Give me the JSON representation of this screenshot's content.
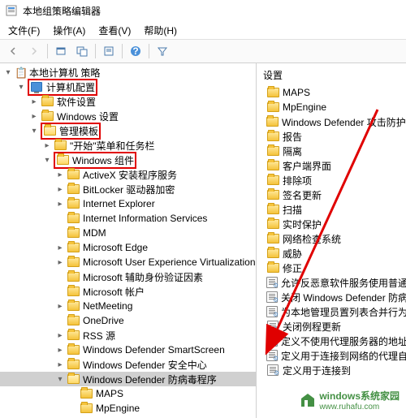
{
  "window": {
    "title": "本地组策略编辑器"
  },
  "menu": {
    "file": "文件(F)",
    "action": "操作(A)",
    "view": "查看(V)",
    "help": "帮助(H)"
  },
  "tree": {
    "root": "本地计算机 策略",
    "computer_config": "计算机配置",
    "software_settings": "软件设置",
    "windows_settings": "Windows 设置",
    "admin_templates": "管理模板",
    "start_taskbar": "\"开始\"菜单和任务栏",
    "windows_components": "Windows 组件",
    "items": [
      "ActiveX 安装程序服务",
      "BitLocker 驱动器加密",
      "Internet Explorer",
      "Internet Information Services",
      "MDM",
      "Microsoft Edge",
      "Microsoft User Experience Virtualization",
      "Microsoft 辅助身份验证因素",
      "Microsoft 帐户",
      "NetMeeting",
      "OneDrive",
      "RSS 源",
      "Windows Defender SmartScreen",
      "Windows Defender 安全中心",
      "Windows Defender 防病毒程序",
      "MAPS",
      "MpEngine"
    ]
  },
  "right": {
    "header": "设置",
    "folders": [
      "MAPS",
      "MpEngine",
      "Windows Defender 攻击防护",
      "报告",
      "隔离",
      "客户端界面",
      "排除项",
      "签名更新",
      "扫描",
      "实时保护",
      "网络检查系统",
      "威胁",
      "修正"
    ],
    "policies": [
      "允许反恶意软件服务使用普通优先",
      "关闭 Windows Defender 防病毒",
      "为本地管理员置列表合并行为",
      "关闭例程更新",
      "定义不使用代理服务器的地址",
      "定义用于连接到网络的代理自动配",
      "定义用于连接到"
    ]
  },
  "watermark": {
    "brand": "windows系统家园",
    "url": "www.ruhafu.com"
  }
}
